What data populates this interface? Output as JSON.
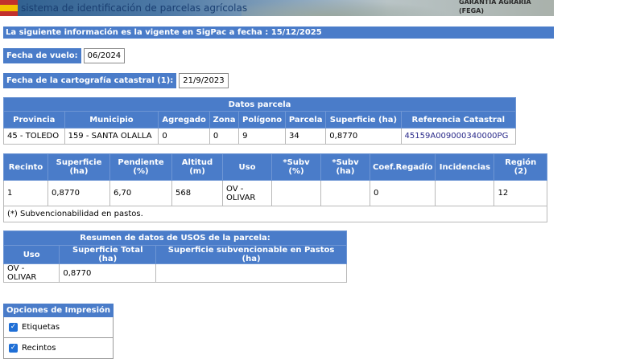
{
  "banner": {
    "subtitle": "sistema de identificación de parcelas agrícolas",
    "right_line1": "GARANTIA AGRARIA",
    "right_line2": "(FEGA)"
  },
  "info_bar": "La siguiente información es la vigente en SigPac a fecha : 15/12/2025",
  "fecha_vuelo": {
    "label": "Fecha de vuelo:",
    "value": "06/2024"
  },
  "fecha_cartografia": {
    "label": "Fecha de la cartografía catastral (1):",
    "value": "21/9/2023"
  },
  "datos_parcela": {
    "title": "Datos parcela",
    "headers": [
      "Provincia",
      "Municipio",
      "Agregado",
      "Zona",
      "Polígono",
      "Parcela",
      "Superficie (ha)",
      "Referencia Catastral"
    ],
    "row": [
      "45 - TOLEDO",
      "159 - SANTA OLALLA",
      "0",
      "0",
      "9",
      "34",
      "0,8770",
      "45159A009000340000PG"
    ]
  },
  "recintos": {
    "headers": [
      "Recinto",
      "Superficie (ha)",
      "Pendiente (%)",
      "Altitud (m)",
      "Uso",
      "*Subv (%)",
      "*Subv (ha)",
      "Coef.Regadío",
      "Incidencias",
      "Región (2)"
    ],
    "row": [
      "1",
      "0,8770",
      "6,70",
      "568",
      "OV - OLIVAR",
      "",
      "",
      "0",
      "",
      "12"
    ],
    "footnote": "(*) Subvencionabilidad en pastos."
  },
  "resumen_usos": {
    "title": "Resumen de datos de USOS de la parcela:",
    "headers": [
      "Uso",
      "Superficie Total (ha)",
      "Superficie subvencionable en Pastos (ha)"
    ],
    "row": [
      "OV - OLIVAR",
      "0,8770",
      ""
    ]
  },
  "opciones": {
    "title": "Opciones de Impresión",
    "items": [
      {
        "label": "Etiquetas",
        "checked": true
      },
      {
        "label": "Recintos",
        "checked": true
      }
    ]
  },
  "colors": {
    "header_blue": "#4a7cc9",
    "link": "#2a2a8a"
  }
}
